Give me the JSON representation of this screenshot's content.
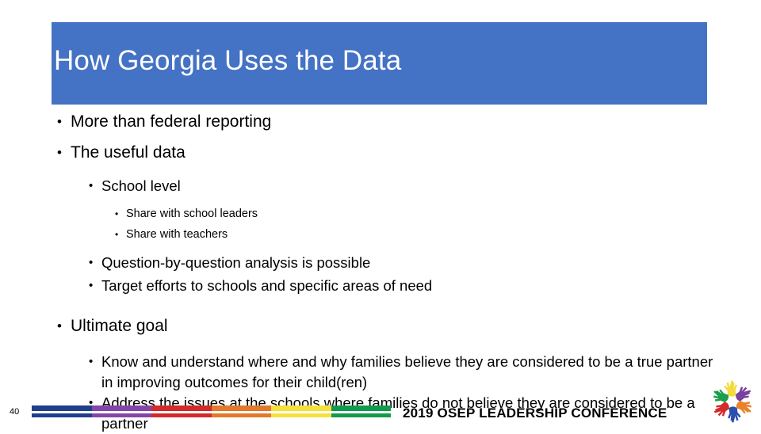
{
  "slide": {
    "title": "How Georgia Uses the Data",
    "banner_color": "#4472C4",
    "title_color": "#FFFFFF",
    "background_color": "#FFFFFF",
    "bullet_glyph": "•"
  },
  "body": {
    "items": [
      {
        "level": 1,
        "text": "More than federal reporting"
      },
      {
        "level": 1,
        "text": "The useful data"
      },
      {
        "level": 2,
        "text": "School level"
      },
      {
        "level": 3,
        "text": "Share with school leaders"
      },
      {
        "level": 3,
        "text": "Share with teachers"
      },
      {
        "level": 2,
        "text": "Question-by-question analysis is possible"
      },
      {
        "level": 2,
        "text": "Target efforts to schools and specific areas of need"
      },
      {
        "level": 1,
        "text": "Ultimate goal"
      },
      {
        "level": 2,
        "text": "Know and understand where and why families believe they are considered to be a true partner in improving outcomes for their child(ren)"
      },
      {
        "level": 2,
        "text": "Address the issues at the schools where families do not believe they are considered to be a partner"
      }
    ]
  },
  "footer": {
    "slide_number": "40",
    "conference_title": "2019 OSEP LEADERSHIP CONFERENCE",
    "color_bar_segments": [
      {
        "name": "navy",
        "color": "#1F3F8C"
      },
      {
        "name": "purple",
        "color": "#8246A8"
      },
      {
        "name": "red",
        "color": "#D32A2A"
      },
      {
        "name": "orange",
        "color": "#E2792B"
      },
      {
        "name": "yellow",
        "color": "#F5E13C"
      },
      {
        "name": "green",
        "color": "#139B4D"
      }
    ],
    "logo": {
      "name": "osep-hands-pinwheel-logo",
      "hand_colors": [
        "#1C9E4C",
        "#F2DB3A",
        "#7B3FA0",
        "#D32A2A",
        "#E8832B",
        "#2B4FAF"
      ]
    }
  }
}
